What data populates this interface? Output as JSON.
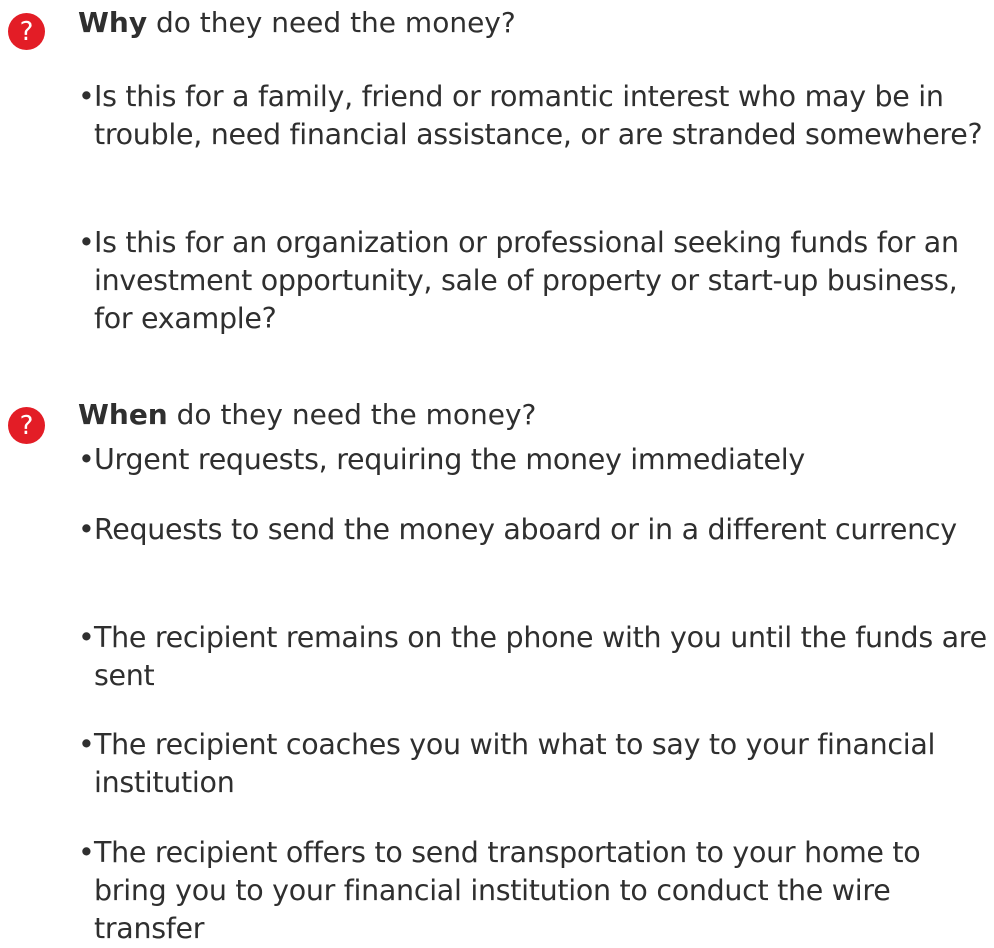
{
  "sections": [
    {
      "icon": "?",
      "heading_bold": "Why",
      "heading_rest": " do they need the money?",
      "bullets": [
        "Is this for a family, friend or romantic interest who may be in trouble, need financial assistance, or are stranded somewhere?",
        "Is this for an organization or professional seeking funds for an investment opportunity, sale of property or start-up business, for example?"
      ]
    },
    {
      "icon": "?",
      "heading_bold": "When",
      "heading_rest": " do they need the money?",
      "bullets": [
        "Urgent requests, requiring the money immediately",
        "Requests to send the money aboard or in a different currency",
        "The recipient remains on the phone with you until the funds are sent",
        "The recipient coaches you with what to say to your financial institution",
        "The recipient offers to send transportation to your home to bring you to your financial institution to conduct the wire transfer"
      ]
    }
  ],
  "bullet_symbol": "•",
  "colors": {
    "icon_background": "#e31d26",
    "text": "#2f2f2f"
  }
}
